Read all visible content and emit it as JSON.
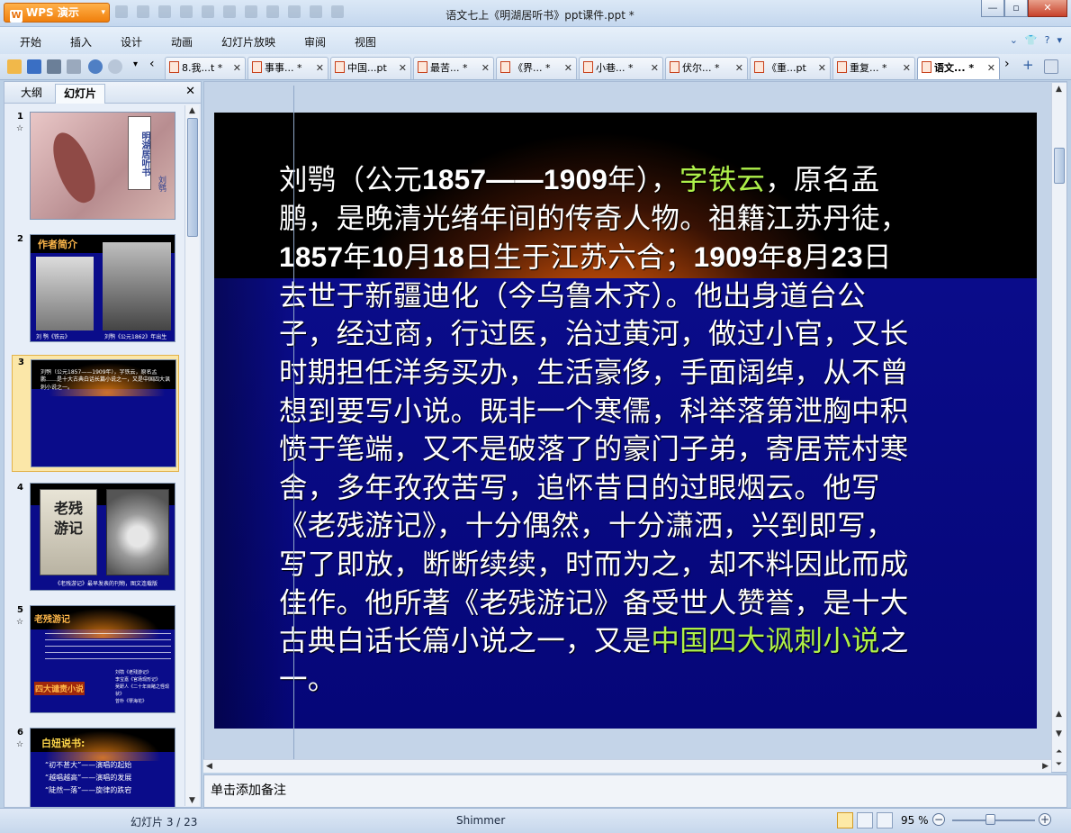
{
  "app": {
    "name": "WPS 演示",
    "window_title": "语文七上《明湖居听书》ppt课件.ppt *"
  },
  "window_controls": {
    "minimize": "—",
    "restore": "▫",
    "close": "✕"
  },
  "menu": [
    "开始",
    "插入",
    "设计",
    "动画",
    "幻灯片放映",
    "审阅",
    "视图"
  ],
  "menu_icons": [
    "chevron-down-icon",
    "shirt-icon",
    "help-icon"
  ],
  "doc_tabs": [
    {
      "label": "8.我...t *",
      "active": false
    },
    {
      "label": "事事... *",
      "active": false
    },
    {
      "label": "中国...pt",
      "active": false
    },
    {
      "label": "最苦... *",
      "active": false
    },
    {
      "label": "《界... *",
      "active": false
    },
    {
      "label": "小巷... *",
      "active": false
    },
    {
      "label": "伏尔... *",
      "active": false
    },
    {
      "label": "《重...pt",
      "active": false
    },
    {
      "label": "重复... *",
      "active": false
    },
    {
      "label": "语文... *",
      "active": true
    }
  ],
  "left_panel": {
    "tabs": [
      "大纲",
      "幻灯片"
    ],
    "active_tab": "幻灯片",
    "close": "✕",
    "thumbnails": [
      {
        "num": "1",
        "title": "明湖居听书",
        "caption": "刘鹗"
      },
      {
        "num": "2",
        "title": "作者简介",
        "caption1": "刘 鹗《铁云》",
        "caption2": "刘鹗《公元1862》年出生"
      },
      {
        "num": "3",
        "selected": true,
        "text": "刘鹗（公元1857——1909年），字铁云，原名孟鹏……是十大古典白话长篇小说之一，又是中国四大讽刺小说之一。"
      },
      {
        "num": "4",
        "caption": "《老残游记》最早发表的刊物，图文连载版"
      },
      {
        "num": "5",
        "title": "老残游记",
        "subtitle": "四大谴责小说",
        "items": [
          "刘鹗《老残游记》",
          "李宝嘉《官场现形记》",
          "吴趼人《二十年目睹之怪现状》",
          "曾朴《孽海花》"
        ]
      },
      {
        "num": "6",
        "title": "白妞说书:",
        "items": [
          "“初不甚大”——演唱的起始",
          "“越唱越高”——演唱的发展",
          "“陡然一落”——旋律的跌宕"
        ]
      }
    ]
  },
  "slide": {
    "lines": [
      [
        {
          "t": "刘鹗（公元"
        },
        {
          "t": "1857——1909",
          "b": true
        },
        {
          "t": "年），"
        },
        {
          "t": "字铁云",
          "hl": true
        },
        {
          "t": "，原名孟"
        }
      ],
      [
        {
          "t": "鹏，是晚清光绪年间的传奇人物。祖籍江苏丹徒，"
        }
      ],
      [
        {
          "t": "1857",
          "b": true
        },
        {
          "t": "年"
        },
        {
          "t": "10",
          "b": true
        },
        {
          "t": "月"
        },
        {
          "t": "18",
          "b": true
        },
        {
          "t": "日生于江苏六合；"
        },
        {
          "t": "1909",
          "b": true
        },
        {
          "t": "年"
        },
        {
          "t": "8",
          "b": true
        },
        {
          "t": "月"
        },
        {
          "t": "23",
          "b": true
        },
        {
          "t": "日"
        }
      ],
      [
        {
          "t": "去世于新疆迪化（今乌鲁木齐）。他出身道台公"
        }
      ],
      [
        {
          "t": "子，经过商，行过医，治过黄河，做过小官，又长"
        }
      ],
      [
        {
          "t": "时期担任洋务买办，生活豪侈，手面阔绰，从不曾"
        }
      ],
      [
        {
          "t": "想到要写小说。既非一个寒儒，科举落第泄胸中积"
        }
      ],
      [
        {
          "t": "愤于笔端，又不是破落了的豪门子弟，寄居荒村寒"
        }
      ],
      [
        {
          "t": "舍，多年孜孜苦写，追怀昔日的过眼烟云。他写"
        }
      ],
      [
        {
          "t": "《老残游记》，十分偶然，十分潇洒，兴到即写，"
        }
      ],
      [
        {
          "t": "写了即放，断断续续，时而为之，却不料因此而成"
        }
      ],
      [
        {
          "t": "佳作。他所著《老残游记》备受世人赞誉，是十大"
        }
      ],
      [
        {
          "t": "古典白话长篇小说之一，又是"
        },
        {
          "t": "中国四大讽刺小说",
          "hl": true
        },
        {
          "t": "之"
        }
      ],
      [
        {
          "t": "一。"
        }
      ]
    ],
    "highlight_color": "#aef04a"
  },
  "notes_placeholder": "单击添加备注",
  "status": {
    "slide_counter": "幻灯片 3 / 23",
    "theme": "Shimmer",
    "zoom": "95 %",
    "zoom_level": 0.5
  }
}
